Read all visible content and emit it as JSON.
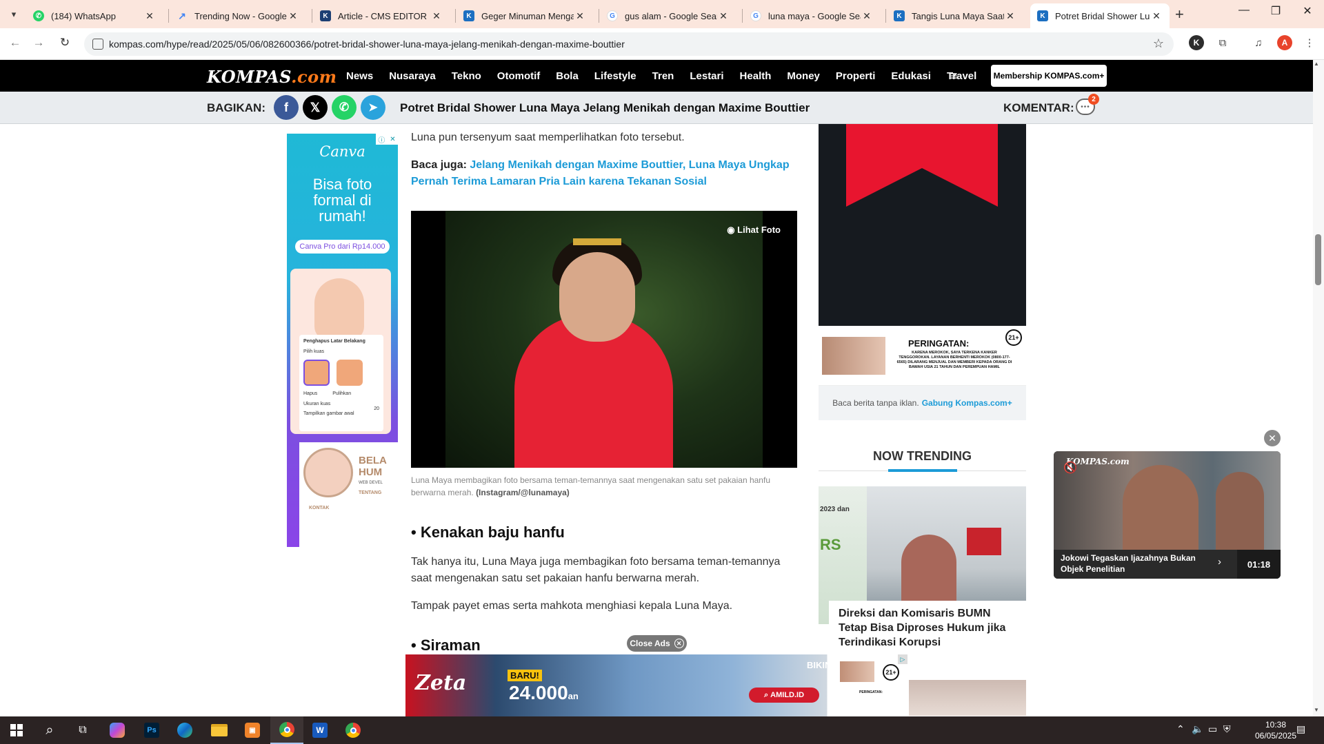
{
  "browser": {
    "tabs": [
      {
        "title": "(184) WhatsApp",
        "favicon": "whatsapp-icon",
        "color": "#25d366"
      },
      {
        "title": "Trending Now - Google Trends",
        "favicon": "google-trends-icon",
        "color": "#4285f4"
      },
      {
        "title": "Article - CMS EDITOR",
        "favicon": "cms-icon",
        "color": "#1c3f73"
      },
      {
        "title": "Geger Minuman Mengandung",
        "favicon": "kompas-icon",
        "color": "#1c6fc1"
      },
      {
        "title": "gus alam - Google Search",
        "favicon": "google-icon",
        "color": "#4285f4"
      },
      {
        "title": "luna maya - Google Search",
        "favicon": "google-icon",
        "color": "#4285f4"
      },
      {
        "title": "Tangis Luna Maya Saat Maxime",
        "favicon": "kompas-icon",
        "color": "#1c6fc1"
      },
      {
        "title": "Potret Bridal Shower Luna Maya",
        "favicon": "kompas-icon",
        "color": "#1c6fc1"
      }
    ],
    "url": "kompas.com/hype/read/2025/05/06/082600366/potret-bridal-shower-luna-maya-jelang-menikah-dengan-maxime-bouttier",
    "profile_initial_1": "K",
    "profile_initial_2": "A"
  },
  "site": {
    "logo_main": "KOMPAS",
    "logo_suffix": ".com",
    "nav": [
      "News",
      "Nusaraya",
      "Tekno",
      "Otomotif",
      "Bola",
      "Lifestyle",
      "Tren",
      "Lestari",
      "Health",
      "Money",
      "Properti",
      "Edukasi",
      "Travel"
    ],
    "membership_label": "Membership KOMPAS.com+"
  },
  "sharebar": {
    "label": "BAGIKAN:",
    "title": "Potret Bridal Shower Luna Maya Jelang Menikah dengan Maxime Bouttier",
    "comment_label": "KOMENTAR:",
    "comment_count": "2"
  },
  "left_ad": {
    "brand": "Canva",
    "headline": "Bisa foto formal di rumah!",
    "cta": "Canva Pro dari Rp14.000",
    "card_title": "Penghapus Latar Belakang",
    "card_option": "Pilih kuas",
    "card_hapus": "Hapus",
    "card_pulihkan": "Pulihkan",
    "card_size_label": "Ukuran kuas",
    "card_size_value": "20",
    "card_toggle_label": "Tampilkan gambar awal",
    "bottom_heading": "BELA HUM",
    "bottom_sub": "WEB DEVEL",
    "bottom_kontak": "KONTAK",
    "bottom_tentang": "TENTANG"
  },
  "article": {
    "para_top": "Luna pun tersenyum saat memperlihatkan foto tersebut.",
    "baca_label": "Baca juga:",
    "baca_link": "Jelang Menikah dengan Maxime Bouttier, Luna Maya Ungkap Pernah Terima Lamaran Pria Lain karena Tekanan Sosial",
    "photo_button": "Lihat Foto",
    "caption": "Luna Maya membagikan foto bersama teman-temannya saat mengenakan satu set pakaian hanfu berwarna merah.",
    "caption_credit": "(Instagram/@lunamaya)",
    "heading_1": "• Kenakan baju hanfu",
    "para_1": "Tak hanya itu, Luna Maya juga membagikan foto bersama teman-temannya saat mengenakan satu set pakaian hanfu berwarna merah.",
    "para_2": "Tampak payet emas serta mahkota menghiasi kepala Luna Maya.",
    "heading_2": "• Siraman"
  },
  "right": {
    "warning_title": "PERINGATAN:",
    "warning_text": "KARENA MEROKOK, SAYA TERKENA KANKER TENGGOROKAN. LAYANAN BERHENTI MEROKOK (0800-177-6565) DILARANG MENJUAL DAN MEMBERI KEPADA ORANG DI BAWAH USIA 21 TAHUN DAN PEREMPUAN HAMIL",
    "age_label": "21+",
    "readfree_text": "Baca berita tanpa iklan.",
    "readfree_link": "Gabung Kompas.com+",
    "trending_title": "NOW TRENDING",
    "trending_item": "Direksi dan Komisaris BUMN Tetap Bisa Diproses Hukum jika Terindikasi Korupsi",
    "trending_img_text_1": "2023 dan",
    "trending_img_text_2": "RS"
  },
  "video": {
    "logo": "KOMPAS.com",
    "title": "Jokowi Tegaskan Ijazahnya Bukan Objek Penelitian",
    "duration": "01:18"
  },
  "bottom_ad": {
    "close_label": "Close Ads",
    "brand": "Zeta",
    "baru": "BARU!",
    "price": "24.000",
    "price_suffix": "an",
    "tagline": "BIKIN LANGKAH BESAR DI",
    "cta": "AMILD.ID",
    "warn_title": "PERINGATAN:",
    "age_label": "21+"
  },
  "taskbar": {
    "time": "10:38",
    "date": "06/05/2025"
  },
  "colors": {
    "kompas_blue": "#1c9bd7",
    "kompas_orange": "#ff7a1a",
    "tabstrip": "#fbe6dd",
    "facebook": "#3b5998",
    "x": "#000000",
    "whatsapp": "#25d366",
    "telegram": "#2aa3dc"
  }
}
